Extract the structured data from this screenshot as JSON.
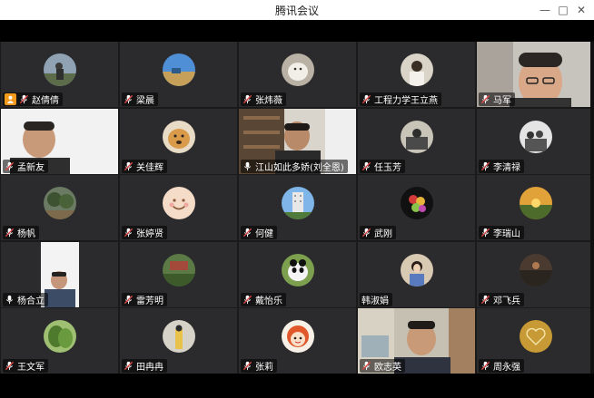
{
  "window": {
    "title": "腾讯会议",
    "minimize": "—",
    "maximize": "□",
    "close": "✕"
  },
  "colors": {
    "tile_bg": "#2b2b2d",
    "active_border": "#39b54a",
    "host_badge": "#f39a1d",
    "mic_muted": "#e04848"
  },
  "participants": [
    {
      "name": "赵倩倩",
      "mic": "muted",
      "host": true,
      "avatar": "photo-person-outdoor"
    },
    {
      "name": "梁晨",
      "mic": "muted",
      "avatar": "photo-landscape-blue-sky"
    },
    {
      "name": "张炜薇",
      "mic": "muted",
      "avatar": "photo-white-pet"
    },
    {
      "name": "工程力学王立燕",
      "mic": "muted",
      "avatar": "photo-person-portrait"
    },
    {
      "name": "马军",
      "mic": "muted",
      "avatar": "video-man-glasses"
    },
    {
      "name": "孟新友",
      "mic": "muted",
      "avatar": "video-man-dark-shirt"
    },
    {
      "name": "关佳辉",
      "mic": "muted",
      "avatar": "photo-golden-dog"
    },
    {
      "name": "江山如此多娇(刘全恩)",
      "mic": "on",
      "avatar": "video-man-bookshelf"
    },
    {
      "name": "任玉芳",
      "mic": "muted",
      "avatar": "photo-person-sitting"
    },
    {
      "name": "李清禄",
      "mic": "muted",
      "avatar": "photo-people-group"
    },
    {
      "name": "杨帆",
      "mic": "muted",
      "avatar": "photo-trees"
    },
    {
      "name": "张婷贤",
      "mic": "muted",
      "avatar": "emoji-smile-face"
    },
    {
      "name": "何健",
      "mic": "muted",
      "avatar": "photo-building"
    },
    {
      "name": "武刚",
      "mic": "muted",
      "avatar": "photo-flowers-dark"
    },
    {
      "name": "李瑞山",
      "mic": "muted",
      "avatar": "photo-sunset-field"
    },
    {
      "name": "杨合立",
      "mic": "on",
      "active": true,
      "avatar": "video-man-room"
    },
    {
      "name": "雷芳明",
      "mic": "muted",
      "avatar": "photo-garden"
    },
    {
      "name": "戴怡乐",
      "mic": "muted",
      "avatar": "photo-panda"
    },
    {
      "name": "韩淑娟",
      "mic": "none",
      "avatar": "photo-woman-portrait"
    },
    {
      "name": "邓飞兵",
      "mic": "muted",
      "avatar": "photo-dark-evening"
    },
    {
      "name": "王文军",
      "mic": "muted",
      "avatar": "photo-green-plant"
    },
    {
      "name": "田冉冉",
      "mic": "muted",
      "avatar": "photo-girl-standing"
    },
    {
      "name": "张莉",
      "mic": "muted",
      "avatar": "cartoon-girl"
    },
    {
      "name": "欧志英",
      "mic": "muted",
      "avatar": "video-man-office"
    },
    {
      "name": "周永强",
      "mic": "muted",
      "avatar": "photo-golden-heart"
    }
  ]
}
